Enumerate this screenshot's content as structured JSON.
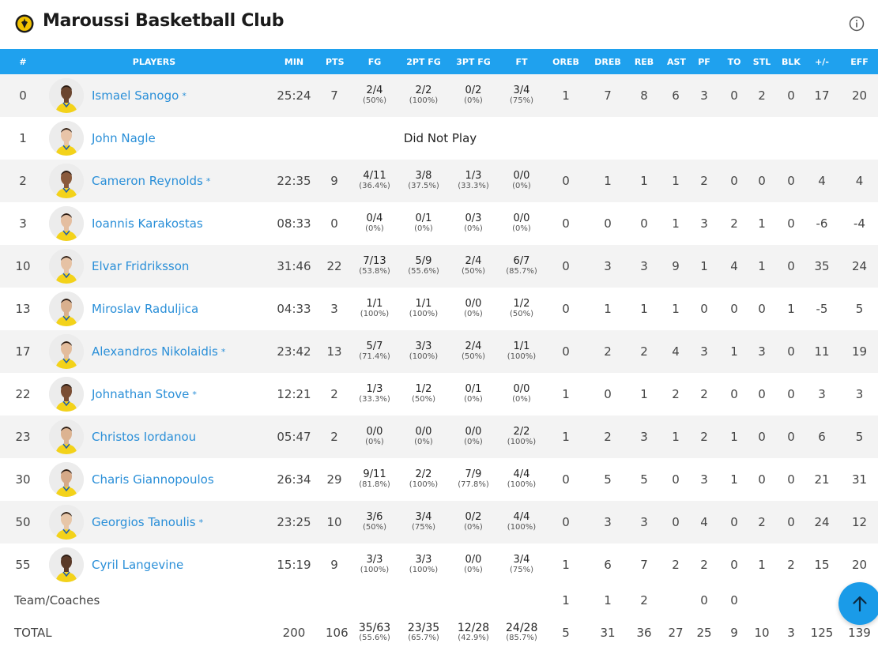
{
  "header": {
    "club_name": "Maroussi Basketball Club",
    "logo_icon": "club-crest-icon",
    "info_icon": "info-icon"
  },
  "colors": {
    "accent": "#1fa1ee",
    "link": "#2a8fd8",
    "row_alt": "#f3f3f3"
  },
  "columns": [
    "#",
    "PLAYERS",
    "MIN",
    "PTS",
    "FG",
    "2PT FG",
    "3PT FG",
    "FT",
    "OREB",
    "DREB",
    "REB",
    "AST",
    "PF",
    "TO",
    "STL",
    "BLK",
    "+/-",
    "EFF"
  ],
  "players": [
    {
      "num": "0",
      "name": "Ismael Sanogo",
      "star": "*",
      "min": "25:24",
      "pts": "7",
      "fg": "2/4",
      "fg_pct": "(50%)",
      "fg2": "2/2",
      "fg2_pct": "(100%)",
      "fg3": "0/2",
      "fg3_pct": "(0%)",
      "ft": "3/4",
      "ft_pct": "(75%)",
      "oreb": "1",
      "dreb": "7",
      "reb": "8",
      "ast": "6",
      "pf": "3",
      "to": "0",
      "stl": "2",
      "blk": "0",
      "pm": "17",
      "eff": "20"
    },
    {
      "num": "1",
      "name": "John Nagle",
      "dnp": "Did Not Play"
    },
    {
      "num": "2",
      "name": "Cameron Reynolds",
      "star": "*",
      "min": "22:35",
      "pts": "9",
      "fg": "4/11",
      "fg_pct": "(36.4%)",
      "fg2": "3/8",
      "fg2_pct": "(37.5%)",
      "fg3": "1/3",
      "fg3_pct": "(33.3%)",
      "ft": "0/0",
      "ft_pct": "(0%)",
      "oreb": "0",
      "dreb": "1",
      "reb": "1",
      "ast": "1",
      "pf": "2",
      "to": "0",
      "stl": "0",
      "blk": "0",
      "pm": "4",
      "eff": "4"
    },
    {
      "num": "3",
      "name": "Ioannis Karakostas",
      "min": "08:33",
      "pts": "0",
      "fg": "0/4",
      "fg_pct": "(0%)",
      "fg2": "0/1",
      "fg2_pct": "(0%)",
      "fg3": "0/3",
      "fg3_pct": "(0%)",
      "ft": "0/0",
      "ft_pct": "(0%)",
      "oreb": "0",
      "dreb": "0",
      "reb": "0",
      "ast": "1",
      "pf": "3",
      "to": "2",
      "stl": "1",
      "blk": "0",
      "pm": "-6",
      "eff": "-4"
    },
    {
      "num": "10",
      "name": "Elvar Fridriksson",
      "min": "31:46",
      "pts": "22",
      "fg": "7/13",
      "fg_pct": "(53.8%)",
      "fg2": "5/9",
      "fg2_pct": "(55.6%)",
      "fg3": "2/4",
      "fg3_pct": "(50%)",
      "ft": "6/7",
      "ft_pct": "(85.7%)",
      "oreb": "0",
      "dreb": "3",
      "reb": "3",
      "ast": "9",
      "pf": "1",
      "to": "4",
      "stl": "1",
      "blk": "0",
      "pm": "35",
      "eff": "24"
    },
    {
      "num": "13",
      "name": "Miroslav Raduljica",
      "min": "04:33",
      "pts": "3",
      "fg": "1/1",
      "fg_pct": "(100%)",
      "fg2": "1/1",
      "fg2_pct": "(100%)",
      "fg3": "0/0",
      "fg3_pct": "(0%)",
      "ft": "1/2",
      "ft_pct": "(50%)",
      "oreb": "0",
      "dreb": "1",
      "reb": "1",
      "ast": "1",
      "pf": "0",
      "to": "0",
      "stl": "0",
      "blk": "1",
      "pm": "-5",
      "eff": "5"
    },
    {
      "num": "17",
      "name": "Alexandros Nikolaidis",
      "star": "*",
      "min": "23:42",
      "pts": "13",
      "fg": "5/7",
      "fg_pct": "(71.4%)",
      "fg2": "3/3",
      "fg2_pct": "(100%)",
      "fg3": "2/4",
      "fg3_pct": "(50%)",
      "ft": "1/1",
      "ft_pct": "(100%)",
      "oreb": "0",
      "dreb": "2",
      "reb": "2",
      "ast": "4",
      "pf": "3",
      "to": "1",
      "stl": "3",
      "blk": "0",
      "pm": "11",
      "eff": "19"
    },
    {
      "num": "22",
      "name": "Johnathan Stove",
      "star": "*",
      "min": "12:21",
      "pts": "2",
      "fg": "1/3",
      "fg_pct": "(33.3%)",
      "fg2": "1/2",
      "fg2_pct": "(50%)",
      "fg3": "0/1",
      "fg3_pct": "(0%)",
      "ft": "0/0",
      "ft_pct": "(0%)",
      "oreb": "1",
      "dreb": "0",
      "reb": "1",
      "ast": "2",
      "pf": "2",
      "to": "0",
      "stl": "0",
      "blk": "0",
      "pm": "3",
      "eff": "3"
    },
    {
      "num": "23",
      "name": "Christos Iordanou",
      "min": "05:47",
      "pts": "2",
      "fg": "0/0",
      "fg_pct": "(0%)",
      "fg2": "0/0",
      "fg2_pct": "(0%)",
      "fg3": "0/0",
      "fg3_pct": "(0%)",
      "ft": "2/2",
      "ft_pct": "(100%)",
      "oreb": "1",
      "dreb": "2",
      "reb": "3",
      "ast": "1",
      "pf": "2",
      "to": "1",
      "stl": "0",
      "blk": "0",
      "pm": "6",
      "eff": "5"
    },
    {
      "num": "30",
      "name": "Charis Giannopoulos",
      "min": "26:34",
      "pts": "29",
      "fg": "9/11",
      "fg_pct": "(81.8%)",
      "fg2": "2/2",
      "fg2_pct": "(100%)",
      "fg3": "7/9",
      "fg3_pct": "(77.8%)",
      "ft": "4/4",
      "ft_pct": "(100%)",
      "oreb": "0",
      "dreb": "5",
      "reb": "5",
      "ast": "0",
      "pf": "3",
      "to": "1",
      "stl": "0",
      "blk": "0",
      "pm": "21",
      "eff": "31"
    },
    {
      "num": "50",
      "name": "Georgios Tanoulis",
      "star": "*",
      "min": "23:25",
      "pts": "10",
      "fg": "3/6",
      "fg_pct": "(50%)",
      "fg2": "3/4",
      "fg2_pct": "(75%)",
      "fg3": "0/2",
      "fg3_pct": "(0%)",
      "ft": "4/4",
      "ft_pct": "(100%)",
      "oreb": "0",
      "dreb": "3",
      "reb": "3",
      "ast": "0",
      "pf": "4",
      "to": "0",
      "stl": "2",
      "blk": "0",
      "pm": "24",
      "eff": "12"
    },
    {
      "num": "55",
      "name": "Cyril Langevine",
      "min": "15:19",
      "pts": "9",
      "fg": "3/3",
      "fg_pct": "(100%)",
      "fg2": "3/3",
      "fg2_pct": "(100%)",
      "fg3": "0/0",
      "fg3_pct": "(0%)",
      "ft": "3/4",
      "ft_pct": "(75%)",
      "oreb": "1",
      "dreb": "6",
      "reb": "7",
      "ast": "2",
      "pf": "2",
      "to": "0",
      "stl": "1",
      "blk": "2",
      "pm": "15",
      "eff": "20"
    }
  ],
  "team_coaches": {
    "label": "Team/Coaches",
    "oreb": "1",
    "dreb": "1",
    "reb": "2",
    "pf": "0",
    "to": "0"
  },
  "total": {
    "label": "TOTAL",
    "min": "200",
    "pts": "106",
    "fg": "35/63",
    "fg_pct": "(55.6%)",
    "fg2": "23/35",
    "fg2_pct": "(65.7%)",
    "fg3": "12/28",
    "fg3_pct": "(42.9%)",
    "ft": "24/28",
    "ft_pct": "(85.7%)",
    "oreb": "5",
    "dreb": "31",
    "reb": "36",
    "ast": "27",
    "pf": "25",
    "to": "9",
    "stl": "10",
    "blk": "3",
    "pm": "125",
    "eff": "139"
  },
  "scroll_top": {
    "icon": "arrow-up-icon"
  }
}
